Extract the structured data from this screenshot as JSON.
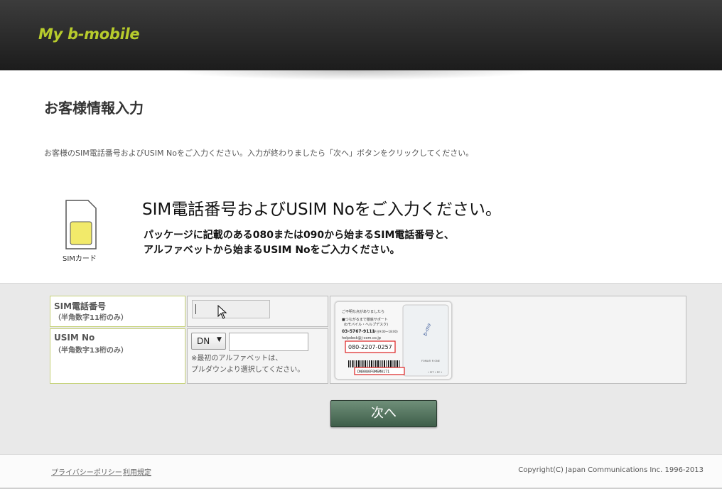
{
  "header": {
    "logo": "My b-mobile"
  },
  "page": {
    "title": "お客様情報入力",
    "instruction": "お客様のSIM電話番号およびUSIM Noをご入力ください。入力が終わりましたら「次へ」ボタンをクリックしてください。"
  },
  "hero": {
    "sim_caption": "SIMカード",
    "headline": "SIM電話番号およびUSIM Noをご入力ください。",
    "desc_line1": "パッケージに記載のある080または090から始まるSIM電話番号と、",
    "desc_line2": "アルファベットから始まるUSIM Noをご入力ください。"
  },
  "form": {
    "tel": {
      "label": "SIM電話番号",
      "sublabel": "（半角数字11桁のみ）",
      "value": ""
    },
    "usim": {
      "label": "USIM No",
      "sublabel": "（半角数字13桁のみ）",
      "prefix_selected": "DN",
      "value": "",
      "note_line1": "※最初のアルファベットは、",
      "note_line2": "プルダウンより選択してください。"
    },
    "card_image": {
      "line1": "ご不明な点がありましたら",
      "line2": "■つながるまで徹底サポート",
      "line3": "(bモバイル・ヘルプデスク)",
      "phone": "03-5767-9111",
      "hours": "(平日9:00〜18:00)",
      "email": "helpdesk@j-com.co.jp",
      "sim_number": "080-2207-0257",
      "barcode_text": "DN0080F0M6M0171",
      "brand": "b-mo",
      "foma": "FOMA® R ONE",
      "small": "• PIT • PC •"
    },
    "submit_label": "次へ"
  },
  "footer": {
    "privacy": "プライバシーポリシー",
    "terms": "利用規定",
    "copyright": "Copyright(C) Japan Communications Inc. 1996-2013"
  },
  "colors": {
    "accent": "#b8cc2c",
    "button": "#4f6f5a",
    "header_bg": "#2a2a2a"
  }
}
